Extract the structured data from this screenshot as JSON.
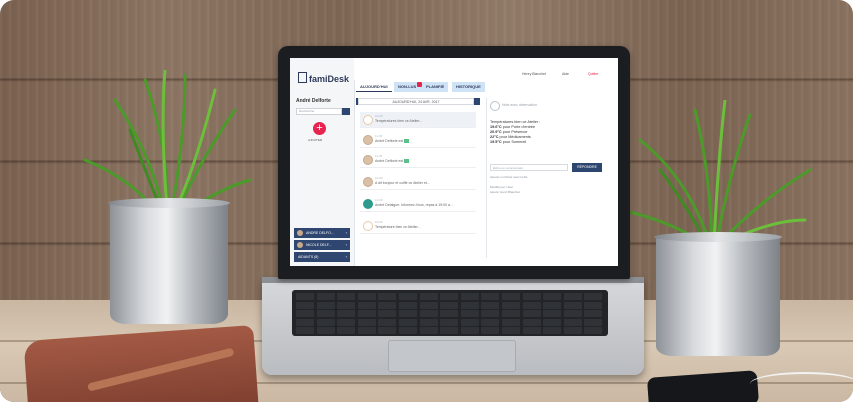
{
  "app": {
    "logo_text": "famiDesk",
    "user_name": "André Delforte",
    "search_placeholder": "Rechercher",
    "add_label": "AJOUTER",
    "topbar_user": "Henry Blanchet",
    "topbar_help": "Aide",
    "topbar_logout": "Quitter"
  },
  "tabs": [
    {
      "label": "AUJOURD'HUI"
    },
    {
      "label": "NON-LUS"
    },
    {
      "label": "PLANIFIÉ"
    },
    {
      "label": "HISTORIQUE"
    }
  ],
  "datebar": "AUJOURD'HUI, 24 AVR. 2017",
  "feed": [
    {
      "time": "10:00",
      "text": "Températures bien ce Atelier..."
    },
    {
      "time": "11:00",
      "text": "André Delforte est"
    },
    {
      "time": "11:45",
      "text": "André Delforte est"
    },
    {
      "time": "12:00",
      "text": "A dit bonjour et coiffé ce Atelier et..."
    },
    {
      "time": "14:00",
      "text": "André Delaigue: Informez-Vous, repas à 19:00 a..."
    },
    {
      "time": "16:00",
      "text": "Température bien ce Atelier..."
    }
  ],
  "side_buttons": [
    {
      "label": "ANDRE DELFO..."
    },
    {
      "label": "NICOLE DELF..."
    },
    {
      "label": "AIDANTS (8)"
    }
  ],
  "note": {
    "header": "Note avec observation",
    "intro": "Températures bien ce Atelier :",
    "lines": [
      {
        "value": "19.6°C",
        "text": "pour Porte d'entrée"
      },
      {
        "value": "20.9°C",
        "text": "pour Présence"
      },
      {
        "value": "22°C",
        "text": "pour Médicaments"
      },
      {
        "value": "19.5°C",
        "text": "pour Sommeil"
      }
    ],
    "reply_placeholder": "Écrire un commentaire",
    "reply_button": "RÉPONDRE",
    "attach": "Ajouter un fichier avec la file",
    "meta1": "Modifié par: Hvar",
    "meta2": "Ajouté: Henri Blanchet"
  },
  "colors": {
    "accent": "#2d4670",
    "alert": "#e6244f",
    "tab_blue": "#cfe3f6"
  }
}
